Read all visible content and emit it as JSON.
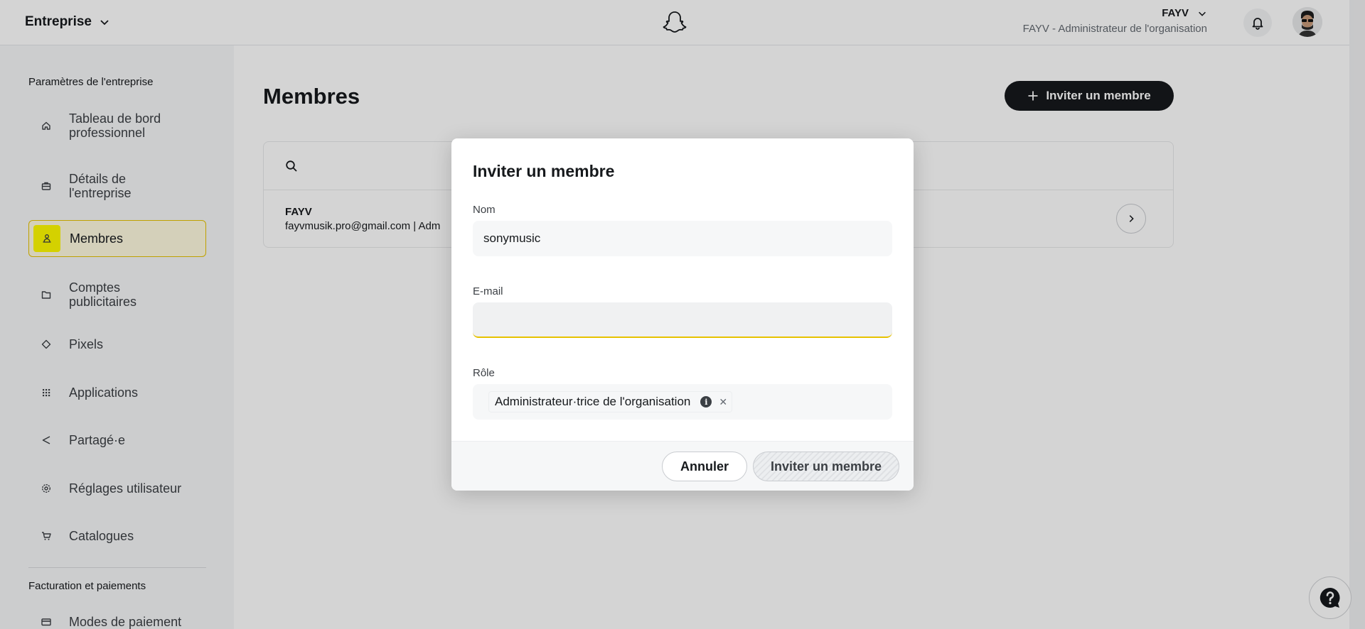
{
  "header": {
    "org_switch": "Entreprise",
    "user_name": "FAYV",
    "user_role": "FAYV - Administrateur de l'organisation"
  },
  "sidebar": {
    "section_settings": "Paramètres de l'entreprise",
    "items": [
      {
        "label": "Tableau de bord professionnel",
        "icon": "home-icon"
      },
      {
        "label": "Détails de l'entreprise",
        "icon": "briefcase-icon"
      },
      {
        "label": "Membres",
        "icon": "members-icon"
      },
      {
        "label": "Comptes publicitaires",
        "icon": "folder-icon"
      },
      {
        "label": "Pixels",
        "icon": "diamond-icon"
      },
      {
        "label": "Applications",
        "icon": "grid-icon"
      },
      {
        "label": "Partagé·e",
        "icon": "share-icon"
      },
      {
        "label": "Réglages utilisateur",
        "icon": "gear-icon"
      },
      {
        "label": "Catalogues",
        "icon": "cart-icon"
      }
    ],
    "section_billing": "Facturation et paiements",
    "billing_items": [
      {
        "label": "Modes de paiement",
        "icon": "credit-card-icon"
      }
    ]
  },
  "main": {
    "title": "Membres",
    "invite_button": "Inviter un membre",
    "members": [
      {
        "name": "FAYV",
        "sub": "fayvmusik.pro@gmail.com | Adm"
      }
    ]
  },
  "modal": {
    "title": "Inviter un membre",
    "name_label": "Nom",
    "name_value": "sonymusic",
    "email_label": "E-mail",
    "email_value": "",
    "role_label": "Rôle",
    "role_value": "Administrateur·trice de l'organisation",
    "cancel_button": "Annuler",
    "submit_button": "Inviter un membre"
  },
  "colors": {
    "accent": "#fffc00",
    "accent_border": "#e6c200",
    "dark_button": "#16191c"
  }
}
